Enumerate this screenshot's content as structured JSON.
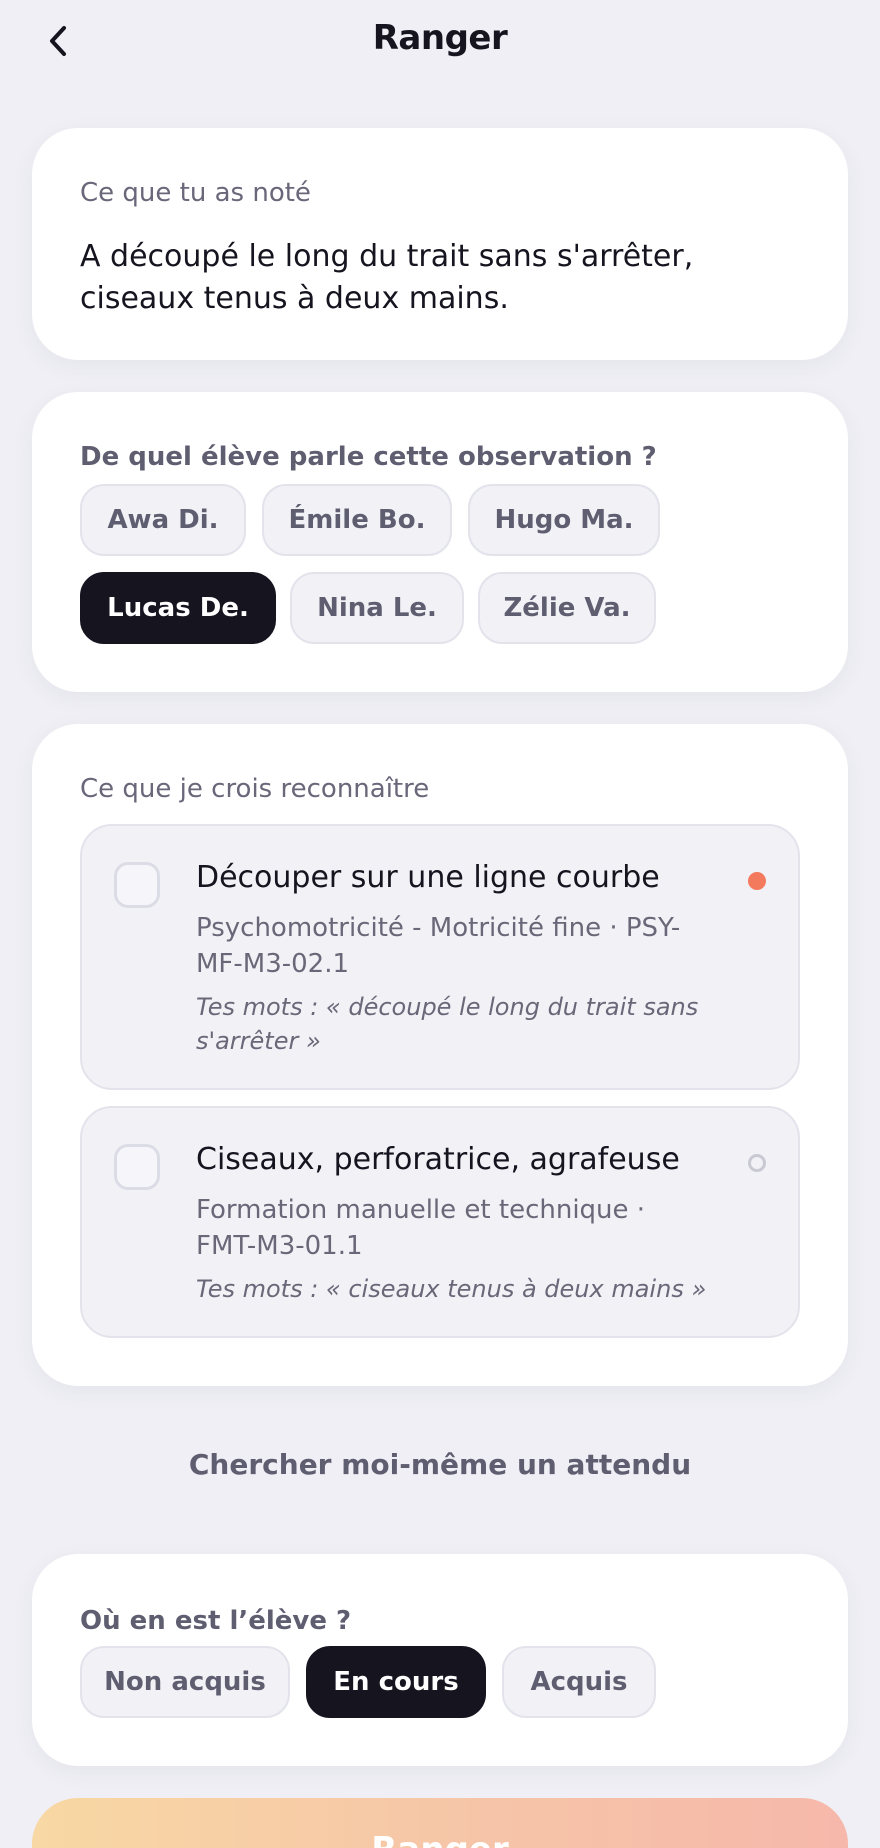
{
  "header": {
    "title": "Ranger"
  },
  "note": {
    "label": "Ce que tu as noté",
    "text": "A découpé le long du trait sans s'arrêter, ciseaux tenus à deux mains."
  },
  "student": {
    "question": "De quel élève parle cette observation ?",
    "options": [
      "Awa Di.",
      "Émile Bo.",
      "Hugo Ma.",
      "Lucas De.",
      "Nina Le.",
      "Zélie Va."
    ],
    "selected": "Lucas De."
  },
  "suggestions": {
    "label": "Ce que je crois reconnaître",
    "items": [
      {
        "title": "Découper sur une ligne courbe",
        "domain": "Psychomotricité - Motricité fine · PSY-MF-M3-02.1",
        "quote": "Tes mots : « découpé le long du trait sans s'arrêter »",
        "indicator_color": "#f47a5e",
        "checked": false
      },
      {
        "title": "Ciseaux, perforatrice, agrafeuse",
        "domain": "Formation manuelle et technique · FMT-M3-01.1",
        "quote": "Tes mots : « ciseaux tenus à deux mains »",
        "indicator_color": "#c9c9d3",
        "checked": false
      }
    ]
  },
  "search_link": "Chercher moi-même un attendu",
  "level": {
    "question": "Où en est l’élève ?",
    "options": [
      "Non acquis",
      "En cours",
      "Acquis"
    ],
    "selected": "En cours"
  },
  "submit_label": "Ranger",
  "colors": {
    "background": "#efeff5",
    "dark": "#15141f",
    "accent": "#f47a5e"
  },
  "icons": {
    "back": "chevron-left-icon"
  }
}
